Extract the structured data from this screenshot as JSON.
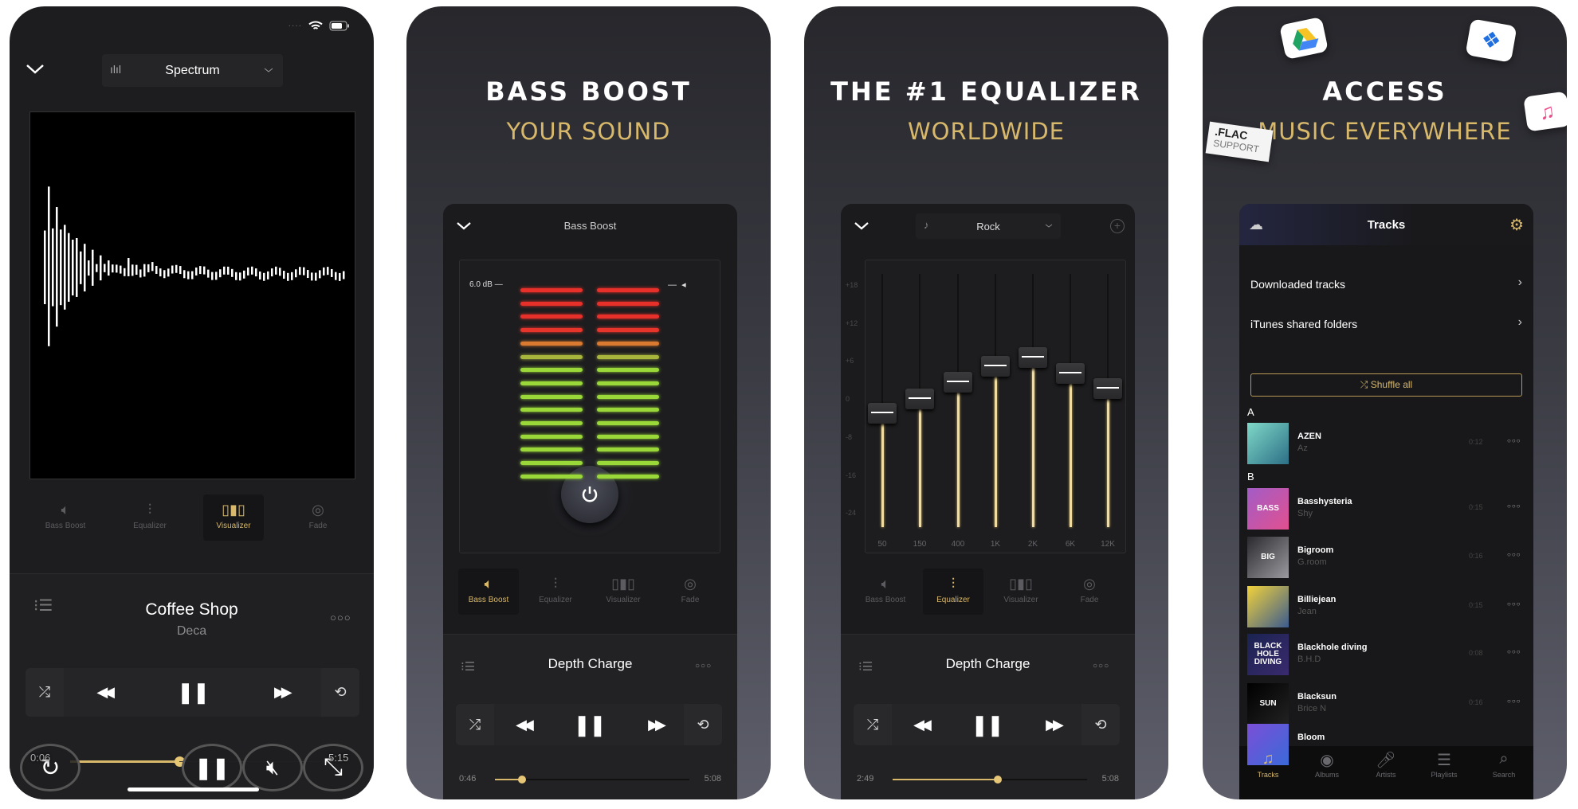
{
  "accent_color": "#d8b86a",
  "panel1": {
    "status_bar": {
      "icons": [
        "signal-dots-icon",
        "wifi-icon",
        "battery-icon"
      ]
    },
    "visualizer_mode": "Spectrum",
    "tabs": [
      {
        "label": "Bass Boost",
        "icon": "speaker-icon",
        "active": false
      },
      {
        "label": "Equalizer",
        "icon": "sliders-icon",
        "active": false
      },
      {
        "label": "Visualizer",
        "icon": "bars-icon",
        "active": true
      },
      {
        "label": "Fade",
        "icon": "fade-icon",
        "active": false
      }
    ],
    "track_title": "Coffee Shop",
    "track_artist": "Deca",
    "time_elapsed": "0:06",
    "time_total": "5:15",
    "progress": 0.45,
    "overlay_buttons": [
      "replay-icon",
      "pause-icon",
      "mute-icon",
      "fullscreen-icon"
    ]
  },
  "panel2": {
    "headline": "BASS BOOST",
    "subheadline": "YOUR SOUND",
    "screen_title": "Bass Boost",
    "db_label": "6.0 dB",
    "meter_colors": [
      "#e8302a",
      "#e8302a",
      "#e8302a",
      "#e8352b",
      "#d97a30",
      "#a8b53c",
      "#9ad83a",
      "#9ad83a",
      "#9ad83a",
      "#9ad83a",
      "#9ad83a",
      "#9ad83a",
      "#9ad83a",
      "#9ad83a",
      "#9ad83a"
    ],
    "tabs": [
      {
        "label": "Bass Boost",
        "icon": "speaker-icon",
        "active": true
      },
      {
        "label": "Equalizer",
        "icon": "sliders-icon",
        "active": false
      },
      {
        "label": "Visualizer",
        "icon": "bars-icon",
        "active": false
      },
      {
        "label": "Fade",
        "icon": "fade-icon",
        "active": false
      }
    ],
    "track_title": "Depth Charge",
    "time_elapsed": "0:46",
    "time_total": "5:08",
    "progress": 0.14
  },
  "panel3": {
    "headline": "THE #1 EQUALIZER",
    "subheadline": "WORLDWIDE",
    "preset": "Rock",
    "db_ticks": [
      "+18",
      "+12",
      "+6",
      "0",
      "-8",
      "-16",
      "-24"
    ],
    "bands": [
      {
        "freq": "50",
        "gain": -3
      },
      {
        "freq": "150",
        "gain": 0
      },
      {
        "freq": "400",
        "gain": 2.7
      },
      {
        "freq": "1K",
        "gain": 5.2
      },
      {
        "freq": "2K",
        "gain": 6.6
      },
      {
        "freq": "6K",
        "gain": 4
      },
      {
        "freq": "12K",
        "gain": 1.6
      }
    ],
    "tabs": [
      {
        "label": "Bass Boost",
        "icon": "speaker-icon",
        "active": false
      },
      {
        "label": "Equalizer",
        "icon": "sliders-icon",
        "active": true
      },
      {
        "label": "Visualizer",
        "icon": "bars-icon",
        "active": false
      },
      {
        "label": "Fade",
        "icon": "fade-icon",
        "active": false
      }
    ],
    "track_title": "Depth Charge",
    "time_elapsed": "2:49",
    "time_total": "5:08",
    "progress": 0.54
  },
  "panel4": {
    "headline": "ACCESS",
    "subheadline": "MUSIC EVERYWHERE",
    "badge_line1": ".FLAC",
    "badge_line2": "SUPPORT",
    "floating_icons": [
      "google-drive-icon",
      "dropbox-icon",
      "apple-music-icon"
    ],
    "screen_title": "Tracks",
    "sources": [
      "Downloaded tracks",
      "iTunes shared folders"
    ],
    "shuffle_label": "Shuffle all",
    "sections": [
      {
        "letter": "A",
        "tracks": [
          {
            "name": "AZEN",
            "artist": "Az",
            "duration": "0:12",
            "cover": [
              "#7fd8c8",
              "#2c6f86"
            ],
            "cover_text": ""
          }
        ]
      },
      {
        "letter": "B",
        "tracks": [
          {
            "name": "Basshysteria",
            "artist": "Shy",
            "duration": "0:15",
            "cover": [
              "#a25cc7",
              "#e2508f"
            ],
            "cover_text": "BASS"
          },
          {
            "name": "Bigroom",
            "artist": "G.room",
            "duration": "0:16",
            "cover": [
              "#2a2a2e",
              "#9a9aa0"
            ],
            "cover_text": "BIG"
          },
          {
            "name": "Billiejean",
            "artist": "Jean",
            "duration": "0:15",
            "cover": [
              "#f2d23a",
              "#3b5b8e"
            ],
            "cover_text": ""
          },
          {
            "name": "Blackhole diving",
            "artist": "B.H.D",
            "duration": "0:08",
            "cover": [
              "#1a2350",
              "#3a2a6e"
            ],
            "cover_text": "BLACK HOLE DIVING"
          },
          {
            "name": "Blacksun",
            "artist": "Brice N",
            "duration": "0:16",
            "cover": [
              "#000000",
              "#222222"
            ],
            "cover_text": "SUN"
          },
          {
            "name": "Bloom",
            "artist": "",
            "duration": "",
            "cover": [
              "#7b4fd8",
              "#3a6ad8"
            ],
            "cover_text": ""
          }
        ]
      }
    ],
    "bottom_tabs": [
      {
        "label": "Tracks",
        "icon": "music-note-icon",
        "active": true
      },
      {
        "label": "Albums",
        "icon": "disc-icon",
        "active": false
      },
      {
        "label": "Artists",
        "icon": "microphone-icon",
        "active": false
      },
      {
        "label": "Playlists",
        "icon": "playlist-icon",
        "active": false
      },
      {
        "label": "Search",
        "icon": "search-icon",
        "active": false
      }
    ]
  }
}
